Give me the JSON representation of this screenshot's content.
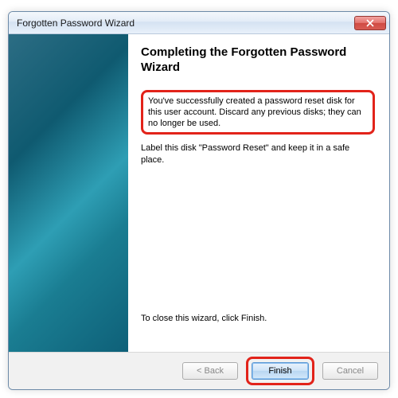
{
  "titlebar": {
    "title": "Forgotten Password Wizard"
  },
  "content": {
    "heading": "Completing the Forgotten Password Wizard",
    "success_msg": "You've successfully created a password reset disk for this user account. Discard any previous disks; they can no longer be used.",
    "label_msg": "Label this disk \"Password Reset\" and keep it in a safe place.",
    "close_hint": "To close this wizard, click Finish."
  },
  "footer": {
    "back_label": "< Back",
    "finish_label": "Finish",
    "cancel_label": "Cancel"
  },
  "colors": {
    "highlight": "#e2231a"
  }
}
